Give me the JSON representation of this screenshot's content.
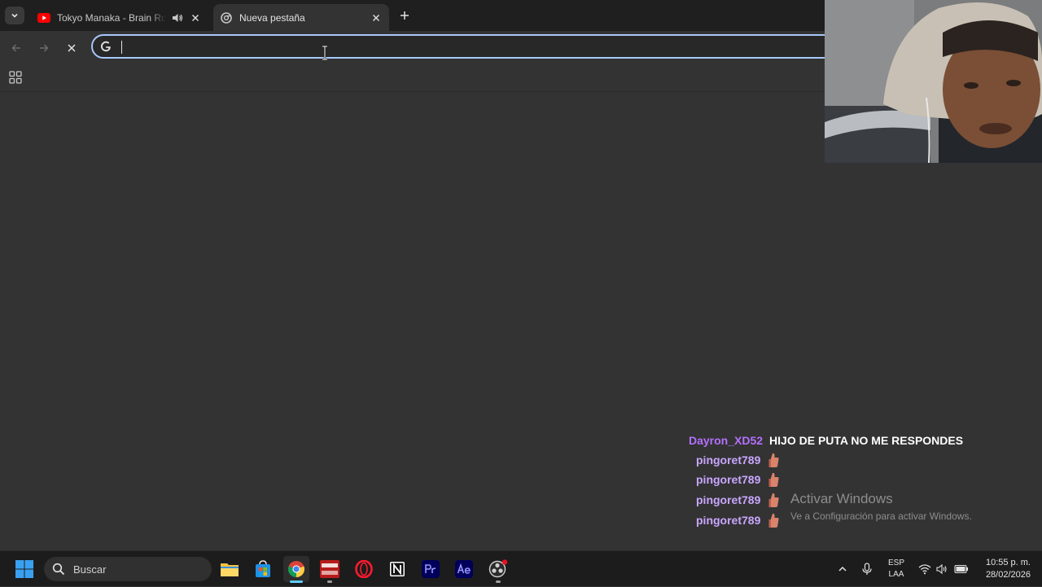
{
  "browser": {
    "tabs": [
      {
        "title": "Tokyo Manaka - Brain Rot fo",
        "active": false,
        "favicon": "youtube-icon",
        "audio": true
      },
      {
        "title": "Nueva pestaña",
        "active": true,
        "favicon": "chrome-newtab-icon",
        "audio": false
      }
    ],
    "omnibox": {
      "value": "",
      "placeholder": ""
    }
  },
  "chat": {
    "messages": [
      {
        "user": "Dayron_XD52",
        "text": "HIJO DE PUTA NO ME RESPONDES"
      },
      {
        "user": "pingoret789",
        "text": ""
      },
      {
        "user": "pingoret789",
        "text": ""
      },
      {
        "user": "pingoret789",
        "text": ""
      },
      {
        "user": "pingoret789",
        "text": ""
      }
    ]
  },
  "watermark": {
    "title": "Activar Windows",
    "subtitle": "Ve a Configuración para activar Windows."
  },
  "taskbar": {
    "search_label": "Buscar",
    "pinned": [
      "file-explorer-icon",
      "microsoft-store-icon",
      "chrome-icon",
      "voicemeeter-icon",
      "opera-icon",
      "notion-icon",
      "premiere-pro-icon",
      "after-effects-icon",
      "obs-icon"
    ],
    "language_line1": "ESP",
    "language_line2": "LAA",
    "time": "10:55 p. m.",
    "date": "28/02/2026"
  },
  "colors": {
    "tabstrip": "#1f1f1f",
    "page_background": "#333333",
    "omnibox_focus": "#a8c7fa",
    "chat_username": "#c9a6ff",
    "chat_username_first": "#b470ff",
    "taskbar": "#1c1c1c"
  }
}
